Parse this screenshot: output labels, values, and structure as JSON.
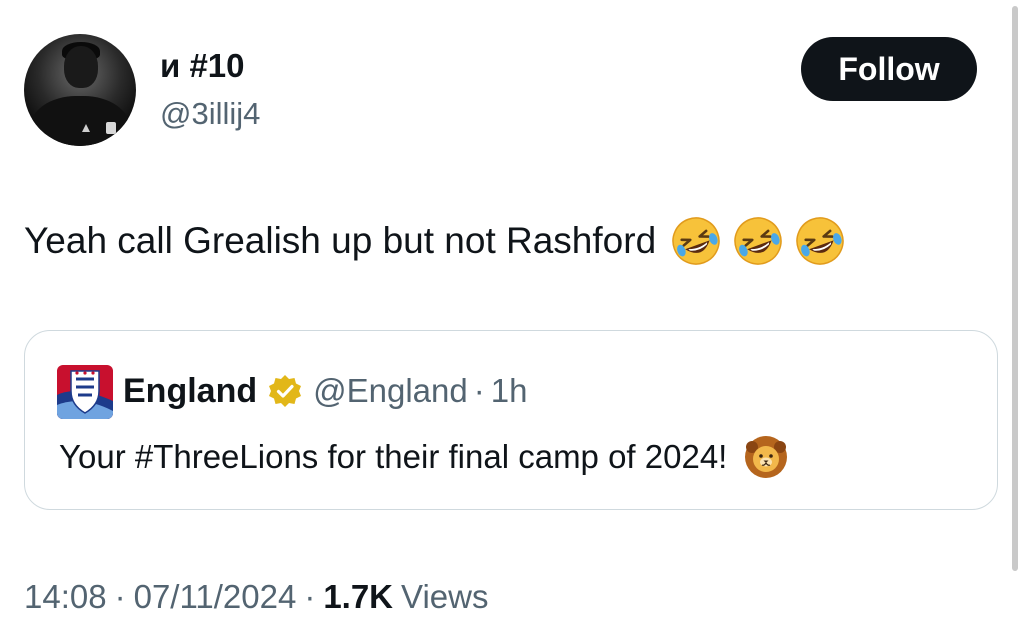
{
  "author": {
    "display_name": "и #10",
    "handle": "@3illij4"
  },
  "follow_button": {
    "label": "Follow"
  },
  "tweet": {
    "text": "Yeah call Grealish up but not Rashford",
    "emojis": [
      "rolling-on-the-floor-laughing",
      "rolling-on-the-floor-laughing",
      "rolling-on-the-floor-laughing"
    ]
  },
  "quoted_tweet": {
    "author_name": "England",
    "verified_badge": "gold-verified-icon",
    "handle": "@England",
    "separator": "·",
    "time": "1h",
    "text": "Your #ThreeLions for their final camp of 2024!",
    "emoji": "lion-face"
  },
  "meta": {
    "time": "14:08",
    "separator": "·",
    "date": "07/11/2024",
    "views_count": "1.7K",
    "views_label": "Views"
  },
  "colors": {
    "text": "#0f1419",
    "secondary_text": "#536471",
    "border": "#cfd9de",
    "follow_bg": "#0f1419",
    "follow_text": "#ffffff",
    "verified_gold": "#e2b719"
  }
}
